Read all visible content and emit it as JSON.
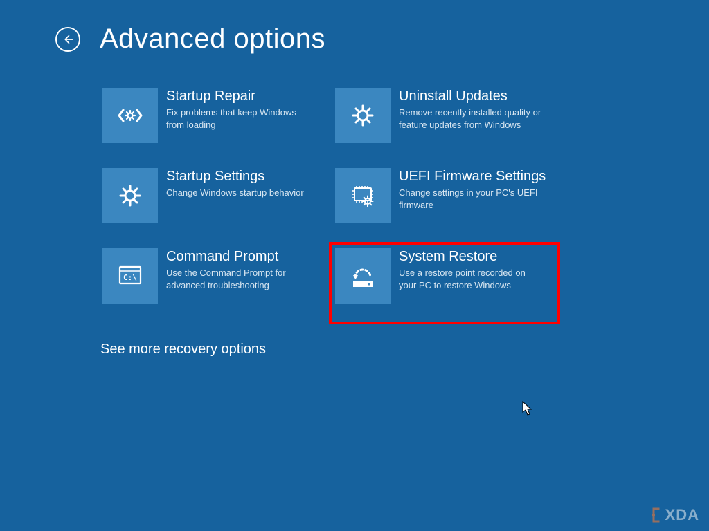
{
  "page": {
    "title": "Advanced options",
    "more_link": "See more recovery options"
  },
  "tiles": {
    "startup_repair": {
      "title": "Startup Repair",
      "desc": "Fix problems that keep Windows from loading"
    },
    "uninstall_updates": {
      "title": "Uninstall Updates",
      "desc": "Remove recently installed quality or feature updates from Windows"
    },
    "startup_settings": {
      "title": "Startup Settings",
      "desc": "Change Windows startup behavior"
    },
    "uefi_firmware": {
      "title": "UEFI Firmware Settings",
      "desc": "Change settings in your PC's UEFI firmware"
    },
    "command_prompt": {
      "title": "Command Prompt",
      "desc": "Use the Command Prompt for advanced troubleshooting"
    },
    "system_restore": {
      "title": "System Restore",
      "desc": "Use a restore point recorded on your PC to restore Windows"
    }
  },
  "watermark": {
    "text": "XDA"
  },
  "colors": {
    "background": "#16629e",
    "tile_icon_bg": "#3b87c0",
    "highlight": "#ff0000"
  }
}
